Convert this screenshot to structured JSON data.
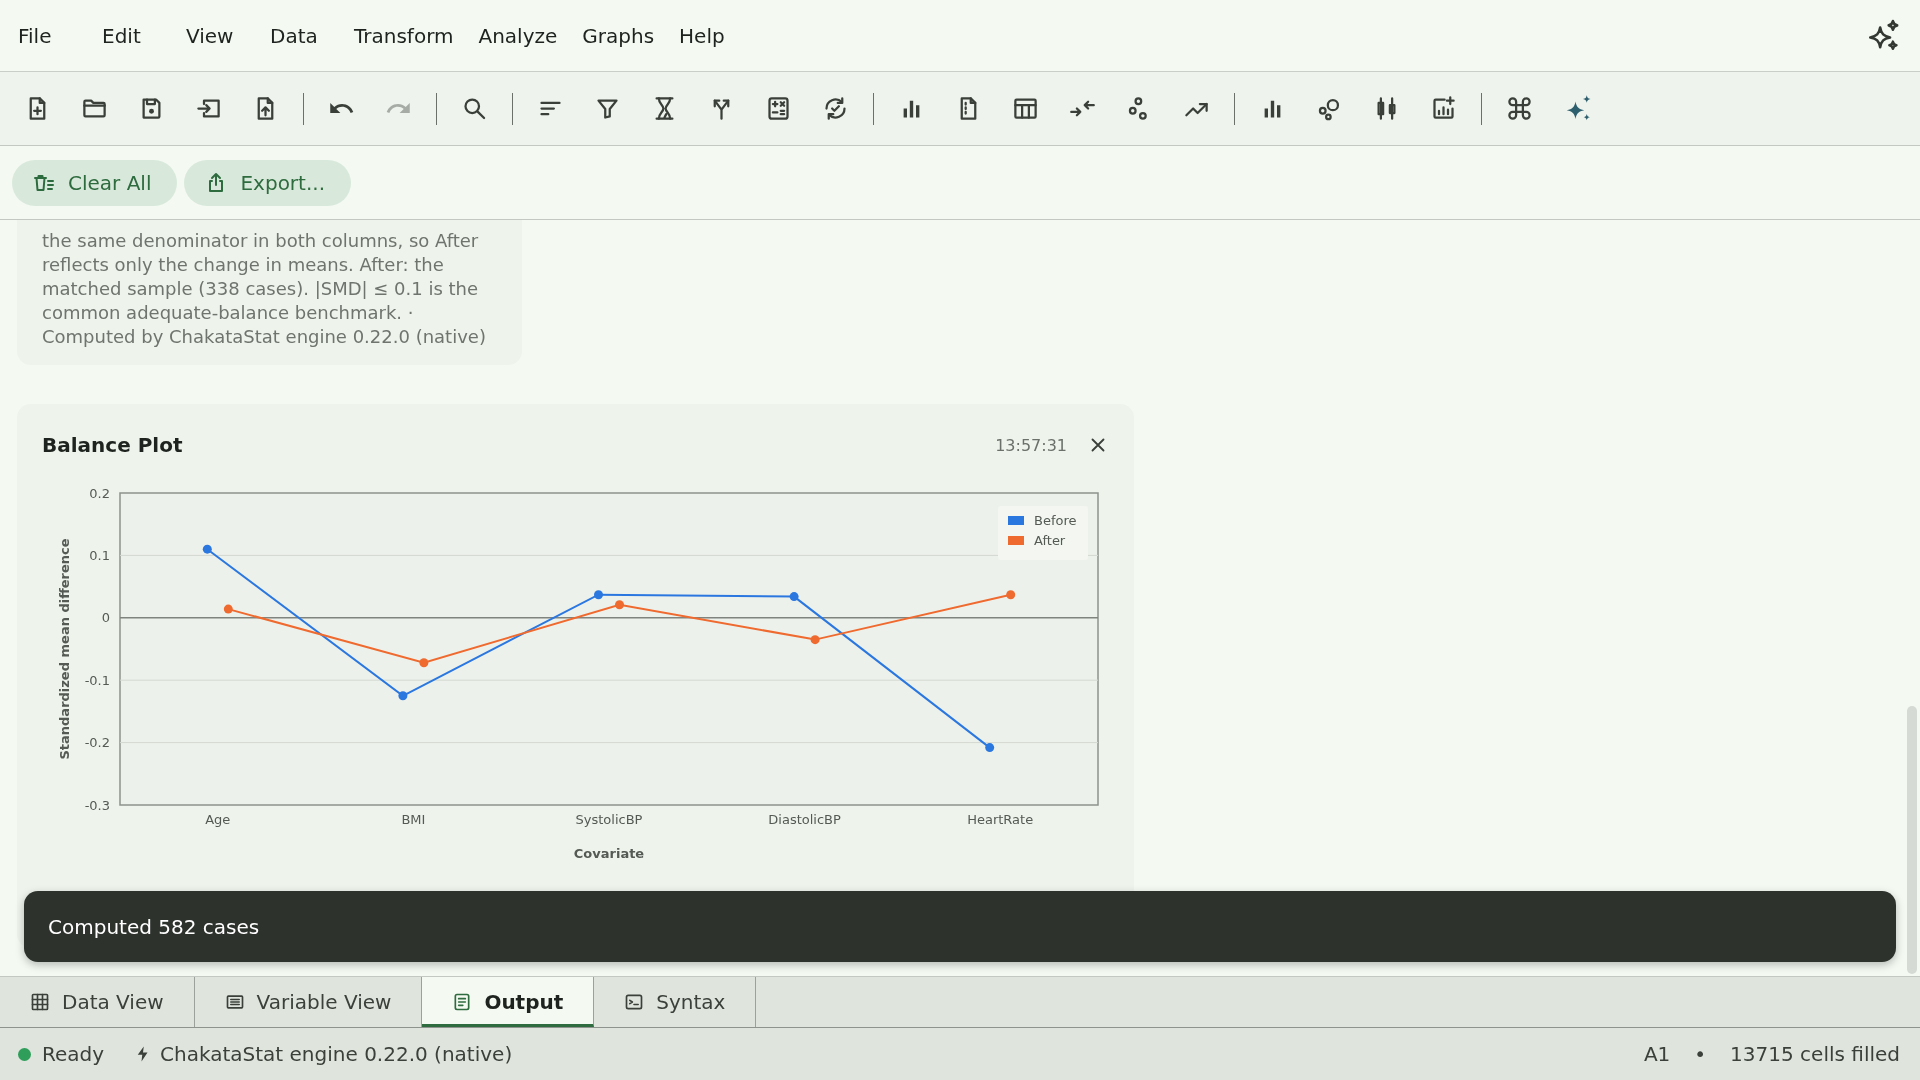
{
  "menu_bar": {
    "items": [
      "File",
      "Edit",
      "View",
      "Data",
      "Transform",
      "Analyze",
      "Graphs",
      "Help"
    ]
  },
  "toolbar": {
    "undo": {
      "disabled": false
    },
    "redo": {
      "disabled": true
    }
  },
  "action_bar": {
    "buttons": [
      "Clear All",
      "Export..."
    ]
  },
  "output": {
    "notes_card": {
      "text": "the same denominator in both columns, so After reflects only the change in means. After: the matched sample (338 cases). |SMD| ≤ 0.1 is the common adequate-balance benchmark. · Computed by ChakataStat engine 0.22.0 (native)"
    },
    "chart_card": {
      "title": "Balance Plot",
      "time": "13:57:31",
      "chart_data": {
        "type": "line",
        "xlabel": "Covariate",
        "ylabel": "Standardized mean difference",
        "categories": [
          "Age",
          "BMI",
          "SystolicBP",
          "DiastolicBP",
          "HeartRate"
        ],
        "series": [
          {
            "name": "Before",
            "color": "#2b77e0",
            "marker": "circle",
            "values": [
              0.11,
              -0.125,
              0.037,
              0.034,
              -0.208
            ]
          },
          {
            "name": "After",
            "color": "#ef6a2f",
            "marker": "circle",
            "values": [
              0.014,
              -0.072,
              0.021,
              -0.035,
              0.037
            ]
          }
        ],
        "ylim": [
          -0.3,
          0.2
        ],
        "yticks": [
          -0.3,
          -0.2,
          -0.1,
          0,
          0.1,
          0.2
        ],
        "grid": true,
        "legend": "upper right"
      }
    }
  },
  "toast": {
    "message": "Computed 582 cases"
  },
  "view_tabs": [
    {
      "label": "Data View",
      "selected": false
    },
    {
      "label": "Variable View",
      "selected": false
    },
    {
      "label": "Output",
      "selected": true
    },
    {
      "label": "Syntax",
      "selected": false
    }
  ],
  "status_bar": {
    "state": "Ready",
    "engine": "ChakataStat engine 0.22.0 (native)",
    "cell": "A1",
    "separator": "•",
    "cells_filled": "13715 cells filled"
  }
}
